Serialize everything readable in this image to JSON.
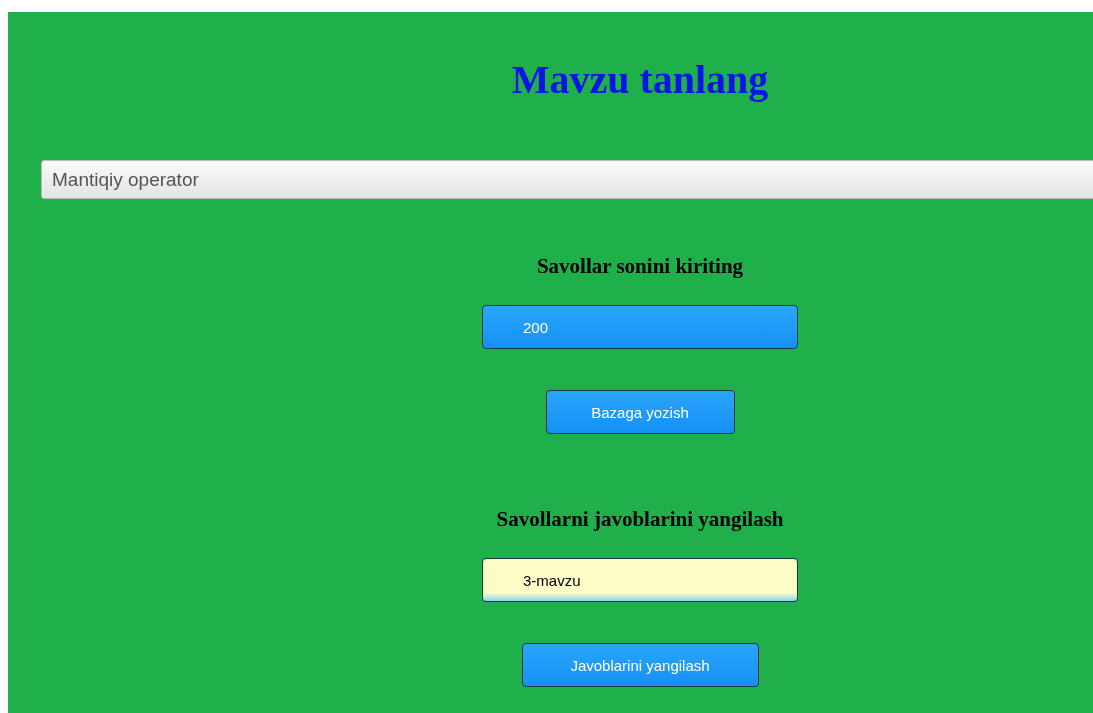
{
  "title": "Mavzu tanlang",
  "topic_select": {
    "value": "Mantiqiy operator"
  },
  "sections": [
    {
      "heading": "Savollar sonini kiriting",
      "field": {
        "kind": "plain",
        "value": "200"
      },
      "button": "Bazaga yozish"
    },
    {
      "heading": "Savollarni javoblarini yangilash",
      "field": {
        "kind": "autofilled",
        "value": "3-mavzu"
      },
      "button": "Javoblarini yangilash"
    }
  ]
}
